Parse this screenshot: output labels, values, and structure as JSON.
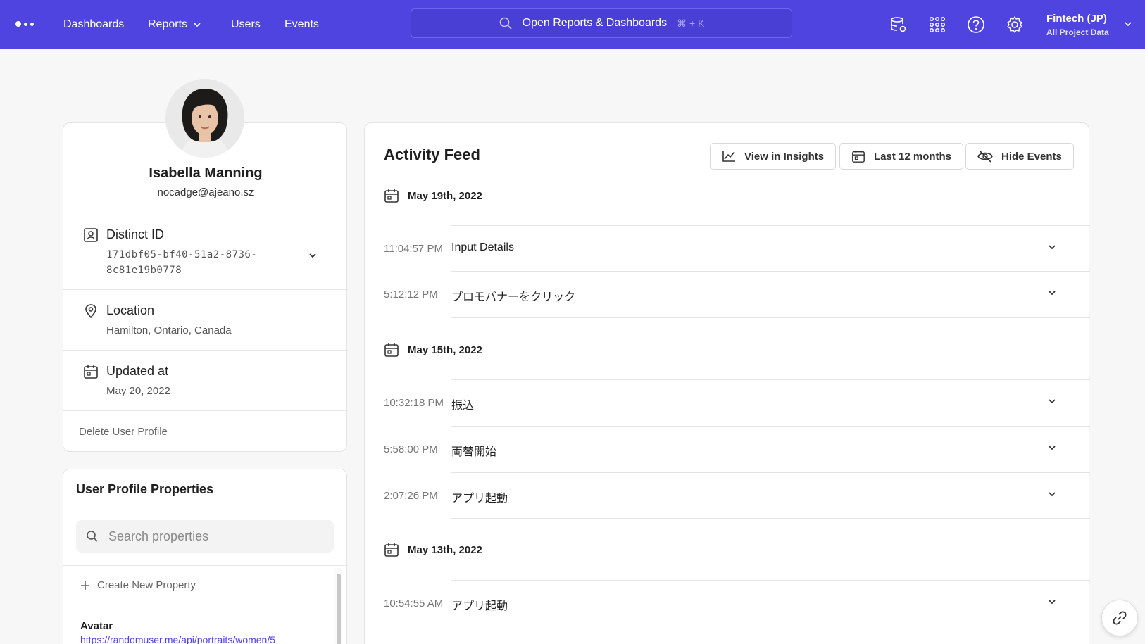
{
  "nav": {
    "links": [
      "Dashboards",
      "Reports",
      "Users",
      "Events"
    ],
    "search_label": "Open Reports & Dashboards",
    "search_shortcut": "⌘ + K",
    "project_name": "Fintech (JP)",
    "project_scope": "All Project Data",
    "icons": [
      "data-management-icon",
      "apps-grid-icon",
      "help-icon",
      "settings-icon"
    ]
  },
  "profile": {
    "name": "Isabella Manning",
    "email": "nocadge@ajeano.sz",
    "distinct_id_label": "Distinct ID",
    "distinct_id_line1": "171dbf05-bf40-51a2-8736-",
    "distinct_id_line2": "8c81e19b0778",
    "location_label": "Location",
    "location_value": "Hamilton, Ontario, Canada",
    "updated_label": "Updated at",
    "updated_value": "May 20, 2022",
    "delete_label": "Delete User Profile"
  },
  "properties": {
    "title": "User Profile Properties",
    "search_placeholder": "Search properties",
    "create_label": "Create New Property",
    "avatar_key": "Avatar",
    "avatar_value": "https://randomuser.me/api/portraits/women/5"
  },
  "feed": {
    "title": "Activity Feed",
    "view_insights": "View in Insights",
    "date_range": "Last 12 months",
    "hide_events": "Hide Events",
    "days": [
      {
        "date": "May 19th, 2022",
        "events": [
          {
            "time": "11:04:57 PM",
            "name": "Input Details"
          },
          {
            "time": "5:12:12 PM",
            "name": "プロモバナーをクリック"
          }
        ]
      },
      {
        "date": "May 15th, 2022",
        "events": [
          {
            "time": "10:32:18 PM",
            "name": "振込"
          },
          {
            "time": "5:58:00 PM",
            "name": "両替開始"
          },
          {
            "time": "2:07:26 PM",
            "name": "アプリ起動"
          }
        ]
      },
      {
        "date": "May 13th, 2022",
        "events": [
          {
            "time": "10:54:55 AM",
            "name": "アプリ起動"
          }
        ]
      }
    ]
  },
  "colors": {
    "nav_bg": "#4f44e0",
    "page_bg": "#f7f7f7",
    "link": "#4f44e0"
  }
}
